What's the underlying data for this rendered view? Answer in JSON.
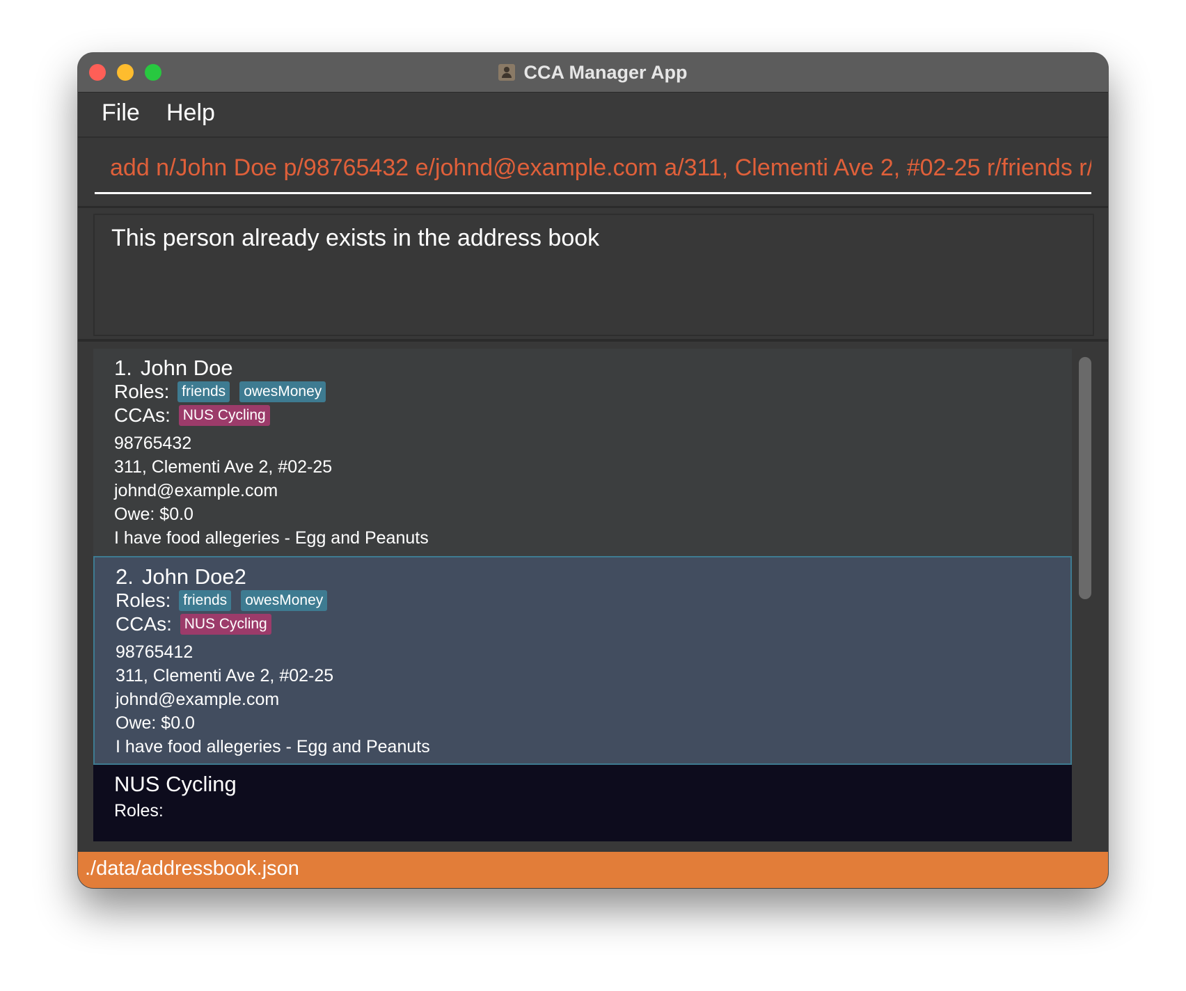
{
  "window": {
    "title": "CCA Manager App"
  },
  "menu": {
    "file": "File",
    "help": "Help"
  },
  "command": {
    "value": "add n/John Doe p/98765432 e/johnd@example.com a/311, Clementi Ave 2, #02-25 r/friends r/c"
  },
  "result": {
    "message": "This person already exists in the address book"
  },
  "persons": [
    {
      "index": "1.",
      "name": "John Doe",
      "roles_label": "Roles:",
      "roles": [
        "friends",
        "owesMoney"
      ],
      "ccas_label": "CCAs:",
      "ccas": [
        "NUS Cycling"
      ],
      "phone": "98765432",
      "address": "311, Clementi Ave 2, #02-25",
      "email": "johnd@example.com",
      "owe": "Owe: $0.0",
      "note": "I have food allegeries - Egg and Peanuts"
    },
    {
      "index": "2.",
      "name": "John Doe2",
      "roles_label": "Roles:",
      "roles": [
        "friends",
        "owesMoney"
      ],
      "ccas_label": "CCAs:",
      "ccas": [
        "NUS Cycling"
      ],
      "phone": "98765412",
      "address": "311, Clementi Ave 2, #02-25",
      "email": "johnd@example.com",
      "owe": "Owe: $0.0",
      "note": "I have food allegeries - Egg and Peanuts"
    }
  ],
  "cca_card": {
    "name": "NUS Cycling",
    "roles_label": "Roles:"
  },
  "status": {
    "path": "./data/addressbook.json"
  },
  "colors": {
    "command_text": "#e0603a",
    "role_tag": "#3e7b91",
    "cca_tag": "#9c3b6a",
    "selected_card": "#424d5f",
    "status_bar": "#e27d39"
  }
}
